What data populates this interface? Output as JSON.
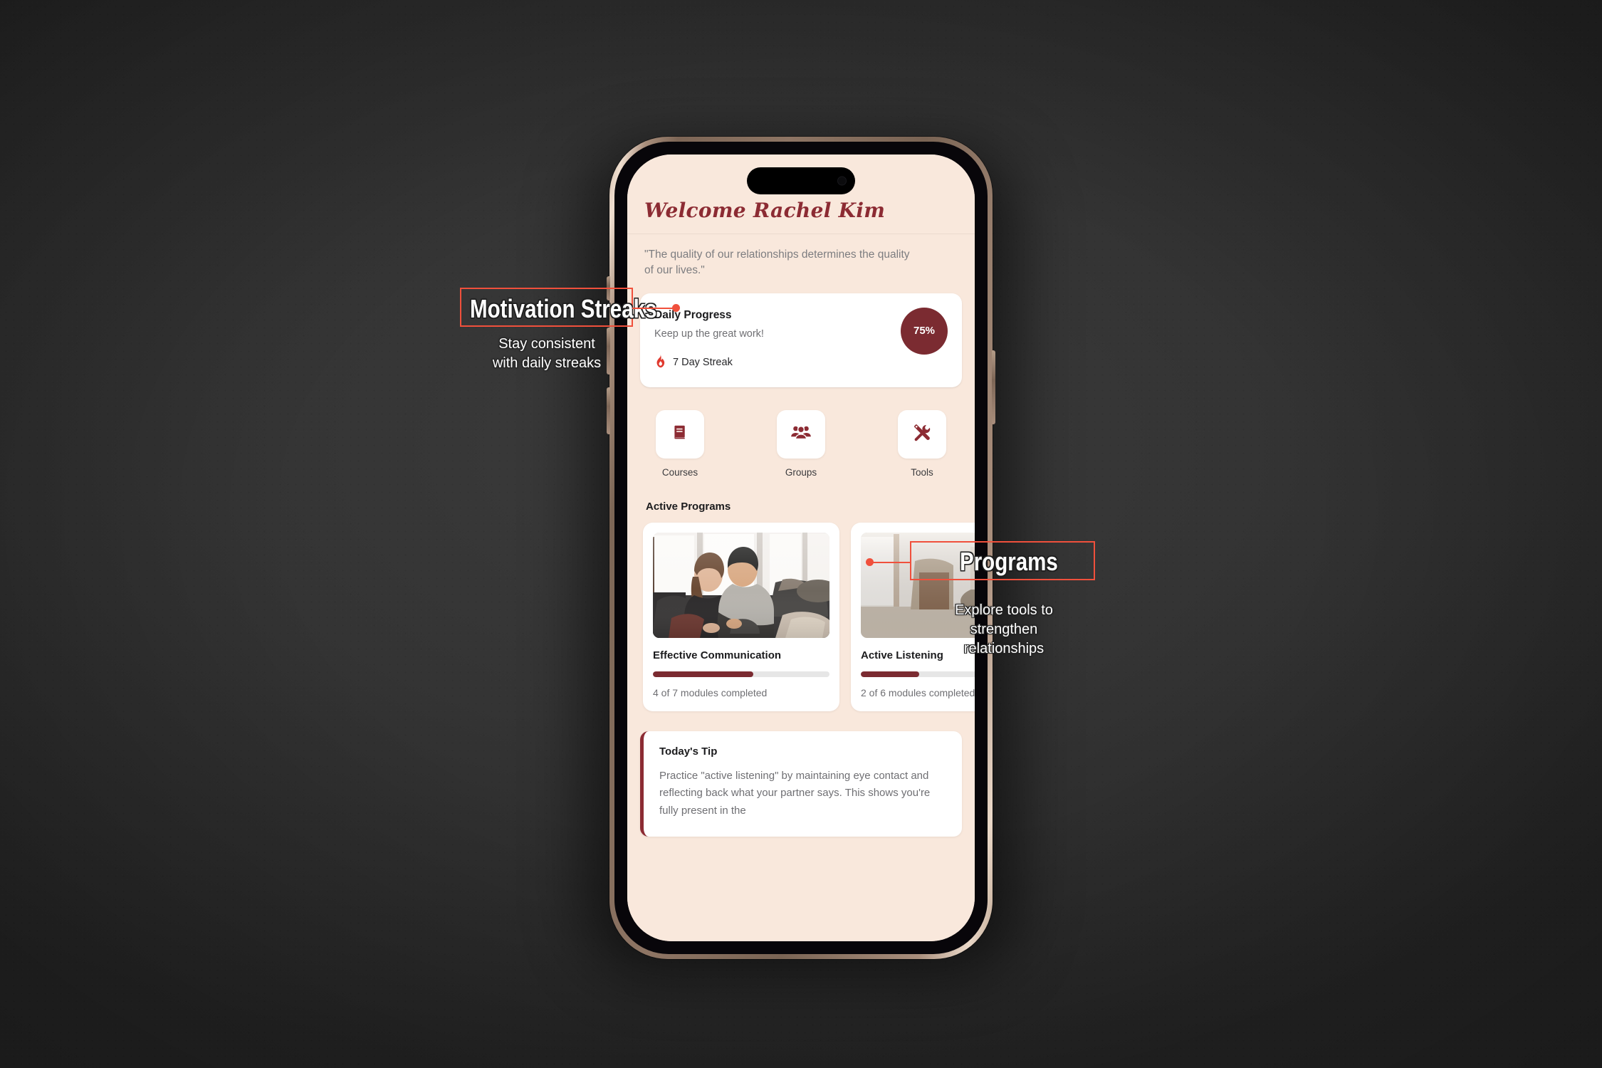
{
  "app": {
    "welcome_title": "Welcome Rachel Kim",
    "quote_line1": "\"The quality of our relationships determines the quality",
    "quote_line2": "of our lives.\"",
    "progress": {
      "title": "Daily Progress",
      "subtitle": "Keep up the great work!",
      "streak_label": "7 Day Streak",
      "badge_value": "75%",
      "percent": 75
    },
    "quick_actions": [
      {
        "label": "Courses",
        "icon": "book-icon"
      },
      {
        "label": "Groups",
        "icon": "people-group-icon"
      },
      {
        "label": "Tools",
        "icon": "tools-icon"
      }
    ],
    "section_heading": "Active Programs",
    "programs": [
      {
        "name": "Effective Communication",
        "meta": "4 of 7 modules completed",
        "percent": 57,
        "photo": "couple-on-sofa-photo"
      },
      {
        "name": "Active Listening",
        "meta": "2 of 6 modules completed",
        "percent": 33,
        "photo": "living-room-photo"
      }
    ],
    "tip": {
      "title": "Today's Tip",
      "line1": "Practice \"active listening\" by maintaining eye",
      "line2": "contact and reflecting back what your partner",
      "line3": "says. This shows you're fully present in the"
    }
  },
  "annotations": [
    {
      "id": "motivation-streaks",
      "title": "Motivation Streaks",
      "desc_line1": "Stay consistent",
      "desc_line2": "with daily streaks"
    },
    {
      "id": "programs",
      "title": "Programs",
      "desc_line1": "Explore tools to",
      "desc_line2": "strengthen",
      "desc_line3": "relationships"
    }
  ],
  "colors": {
    "accent_maroon": "#7b2b31",
    "brand_red": "#8c2b33",
    "screen_bg": "#f9e8dc",
    "annotation_red": "#f0503c",
    "backdrop": "#333333"
  }
}
